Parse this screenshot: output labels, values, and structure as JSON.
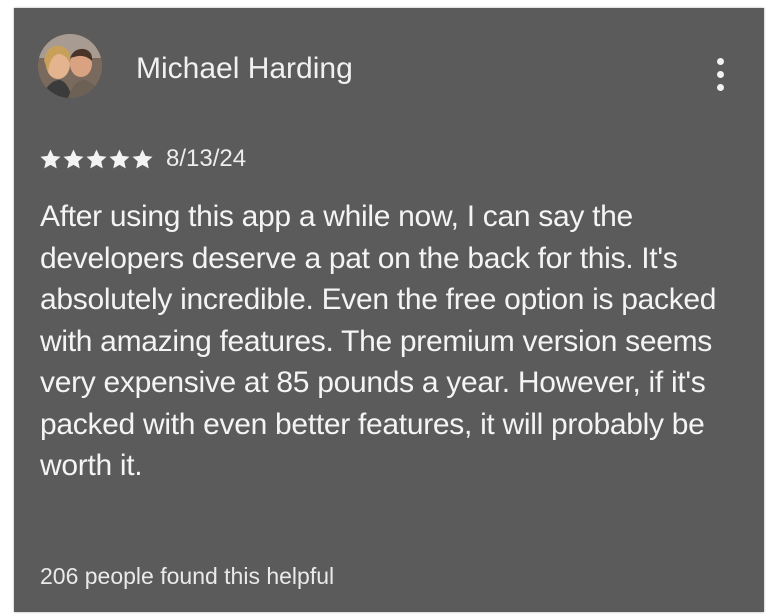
{
  "review": {
    "reviewer_name": "Michael Harding",
    "avatar_icon": "reviewer-avatar-photo",
    "more_icon": "more-vertical-icon",
    "rating_stars": 5,
    "rating_max": 5,
    "date": "8/13/24",
    "body": "After using this app a while now, I can say the developers deserve a pat on the back for this. It's absolutely incredible. Even the free option is packed with amazing features. The premium version seems very expensive at 85 pounds a year. However, if it's packed with even better features, it will probably be worth it.",
    "helpful_text": "206 people found this helpful"
  },
  "colors": {
    "card_background": "#5b5b5b",
    "text": "#f3f3f3",
    "star": "#f3f3f3"
  }
}
